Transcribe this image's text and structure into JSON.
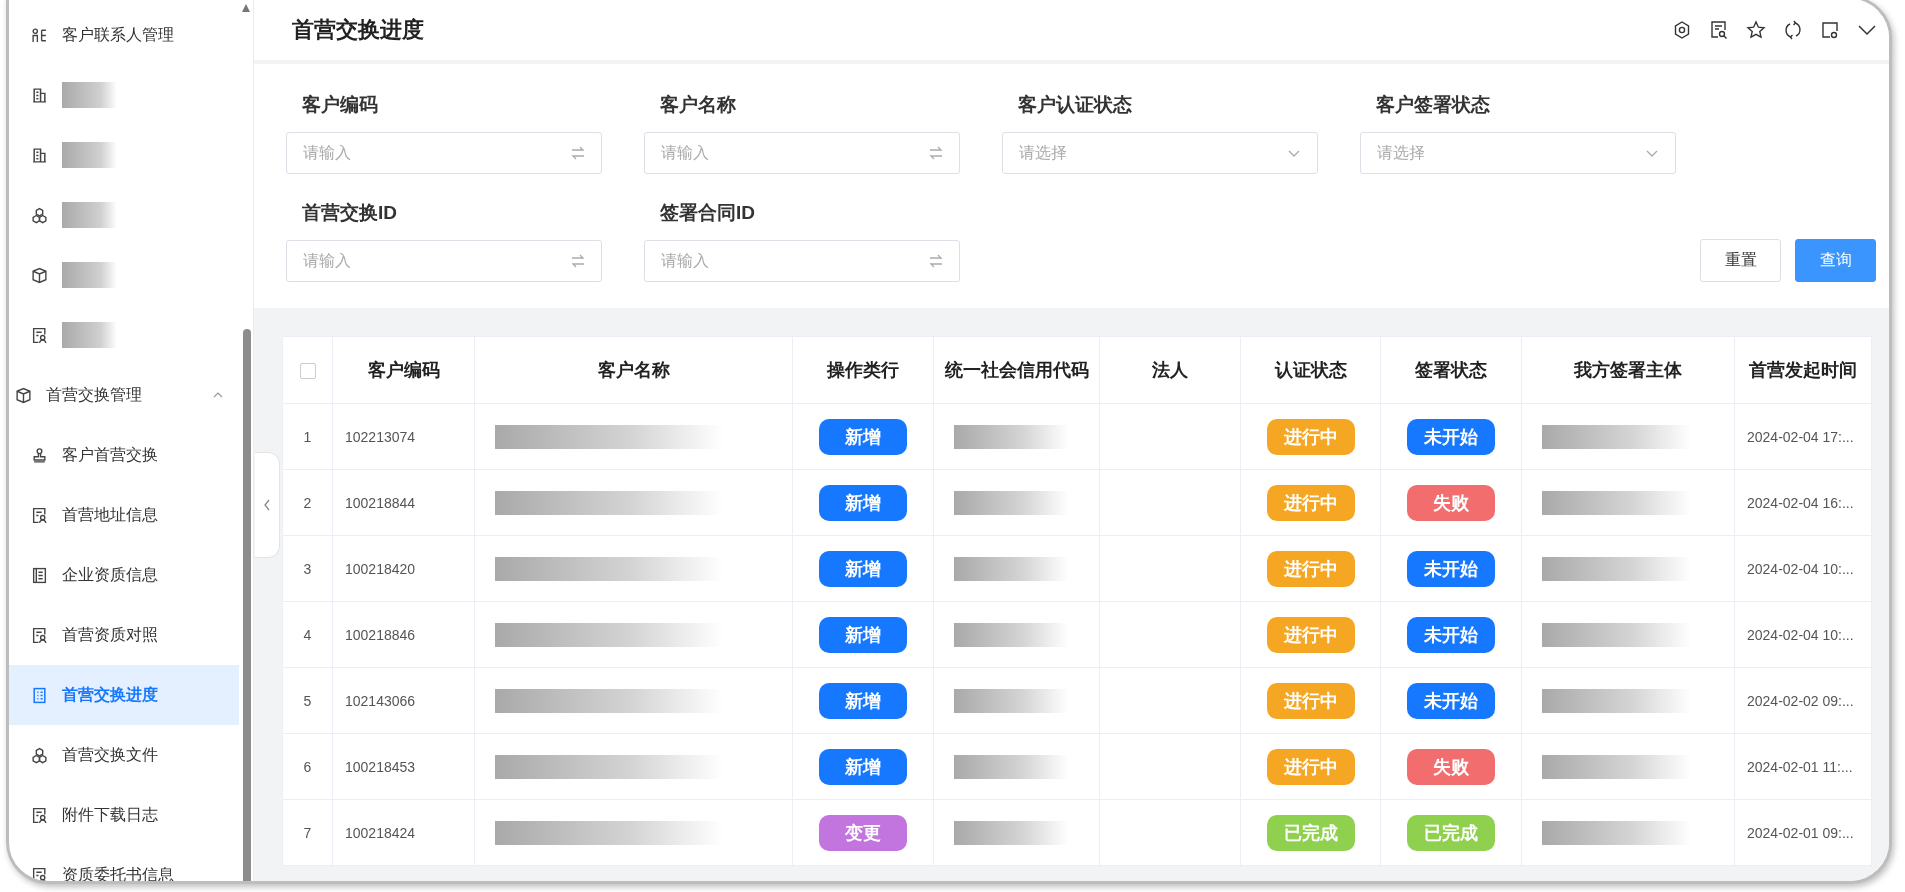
{
  "sidebar": {
    "items": [
      {
        "kind": "link",
        "label": "客户联系人管理",
        "selected": false
      },
      {
        "kind": "redacted",
        "selected": false
      },
      {
        "kind": "redacted",
        "selected": false
      },
      {
        "kind": "redacted",
        "selected": false
      },
      {
        "kind": "redacted",
        "selected": false
      },
      {
        "kind": "redacted",
        "selected": false
      },
      {
        "kind": "group",
        "label": "首营交换管理",
        "selected": false,
        "expanded": true,
        "children": [
          {
            "label": "客户首营交换",
            "selected": false
          },
          {
            "label": "首营地址信息",
            "selected": false
          },
          {
            "label": "企业资质信息",
            "selected": false
          },
          {
            "label": "首营资质对照",
            "selected": false
          },
          {
            "label": "首营交换进度",
            "selected": true
          },
          {
            "label": "首营交换文件",
            "selected": false
          },
          {
            "label": "附件下载日志",
            "selected": false
          },
          {
            "label": "资质委托书信息",
            "selected": false
          }
        ]
      }
    ]
  },
  "page": {
    "title": "首营交换进度"
  },
  "filters": [
    {
      "kind": "input",
      "label": "客户编码",
      "placeholder": "请输入"
    },
    {
      "kind": "input",
      "label": "客户名称",
      "placeholder": "请输入"
    },
    {
      "kind": "select",
      "label": "客户认证状态",
      "placeholder": "请选择"
    },
    {
      "kind": "select",
      "label": "客户签署状态",
      "placeholder": "请选择"
    },
    {
      "kind": "input",
      "label": "首营交换ID",
      "placeholder": "请输入"
    },
    {
      "kind": "input",
      "label": "签署合同ID",
      "placeholder": "请输入"
    }
  ],
  "buttons": [
    {
      "kind": "default",
      "label": "重置"
    },
    {
      "kind": "primary",
      "label": "查询"
    }
  ],
  "table": {
    "columns": [
      {
        "kind": "index",
        "checked": false
      },
      {
        "kind": "code",
        "label": "客户编码"
      },
      {
        "kind": "redacted",
        "label": "客户名称"
      },
      {
        "kind": "operation",
        "label": "操作类行"
      },
      {
        "kind": "redacted",
        "label": "统一社会信用代码"
      },
      {
        "kind": "blank",
        "label": "法人"
      },
      {
        "kind": "auth",
        "label": "认证状态"
      },
      {
        "kind": "sign",
        "label": "签署状态"
      },
      {
        "kind": "redacted",
        "label": "我方签署主体"
      },
      {
        "kind": "time",
        "label": "首营发起时间"
      }
    ],
    "rows": [
      {
        "index": "1",
        "code": "102213074",
        "operation": {
          "label": "新增",
          "color": "#1677ff"
        },
        "auth": {
          "label": "进行中",
          "color": "#f5a623"
        },
        "sign": {
          "label": "未开始",
          "color": "#1677ff"
        },
        "time": "2024-02-04 17:..."
      },
      {
        "index": "2",
        "code": "100218844",
        "operation": {
          "label": "新增",
          "color": "#1677ff"
        },
        "auth": {
          "label": "进行中",
          "color": "#f5a623"
        },
        "sign": {
          "label": "失败",
          "color": "#f26d6d"
        },
        "time": "2024-02-04 16:..."
      },
      {
        "index": "3",
        "code": "100218420",
        "operation": {
          "label": "新增",
          "color": "#1677ff"
        },
        "auth": {
          "label": "进行中",
          "color": "#f5a623"
        },
        "sign": {
          "label": "未开始",
          "color": "#1677ff"
        },
        "time": "2024-02-04 10:..."
      },
      {
        "index": "4",
        "code": "100218846",
        "operation": {
          "label": "新增",
          "color": "#1677ff"
        },
        "auth": {
          "label": "进行中",
          "color": "#f5a623"
        },
        "sign": {
          "label": "未开始",
          "color": "#1677ff"
        },
        "time": "2024-02-04 10:..."
      },
      {
        "index": "5",
        "code": "102143066",
        "operation": {
          "label": "新增",
          "color": "#1677ff"
        },
        "auth": {
          "label": "进行中",
          "color": "#f5a623"
        },
        "sign": {
          "label": "未开始",
          "color": "#1677ff"
        },
        "time": "2024-02-02 09:..."
      },
      {
        "index": "6",
        "code": "100218453",
        "operation": {
          "label": "新增",
          "color": "#1677ff"
        },
        "auth": {
          "label": "进行中",
          "color": "#f5a623"
        },
        "sign": {
          "label": "失败",
          "color": "#f26d6d"
        },
        "time": "2024-02-01 11:..."
      },
      {
        "index": "7",
        "code": "100218424",
        "operation": {
          "label": "变更",
          "color": "#c274df"
        },
        "auth": {
          "label": "已完成",
          "color": "#8fd14f"
        },
        "sign": {
          "label": "已完成",
          "color": "#8fd14f"
        },
        "time": "2024-02-01 09:..."
      }
    ]
  }
}
